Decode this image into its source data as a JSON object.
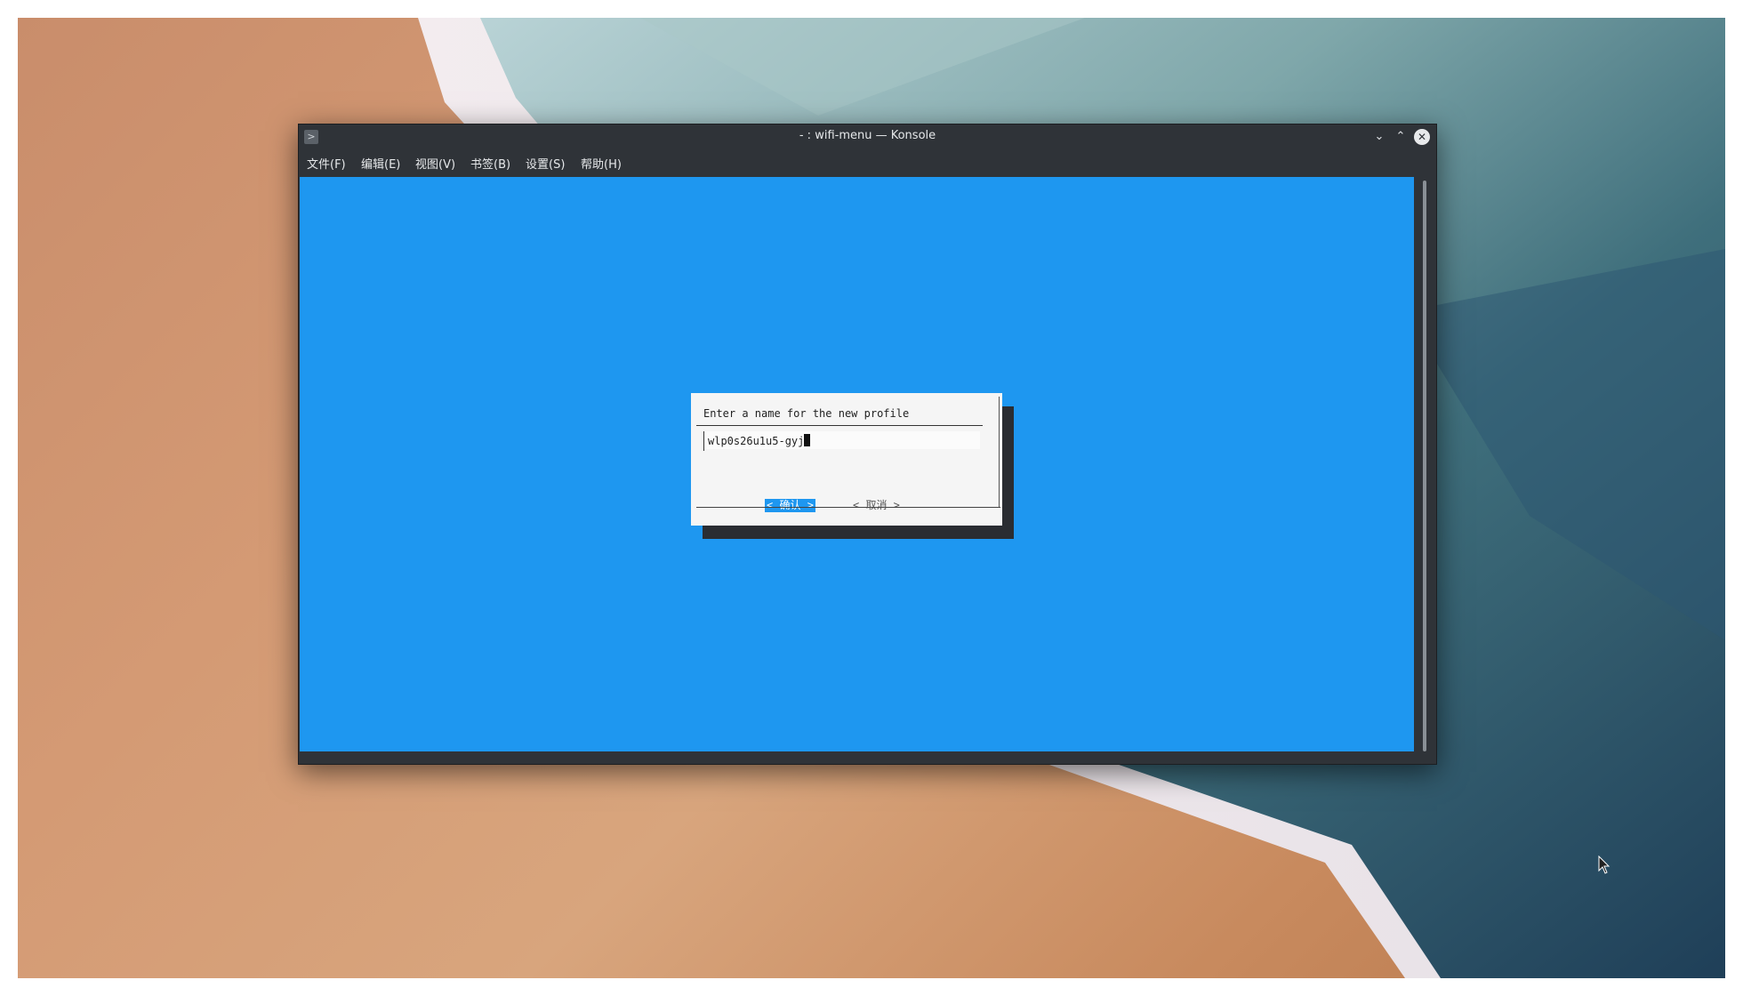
{
  "window": {
    "title": "- : wifi-menu — Konsole",
    "app_icon": "terminal-icon"
  },
  "window_controls": {
    "minimize": "chevron-down-icon",
    "maximize": "chevron-up-icon",
    "close": "close-icon"
  },
  "menubar": {
    "items": [
      {
        "label": "文件(F)"
      },
      {
        "label": "编辑(E)"
      },
      {
        "label": "视图(V)"
      },
      {
        "label": "书签(B)"
      },
      {
        "label": "设置(S)"
      },
      {
        "label": "帮助(H)"
      }
    ]
  },
  "dialog": {
    "prompt": "Enter a name for the new profile",
    "input_value": "wlp0s26u1u5-gyj",
    "ok_label": "< 确认 >",
    "cancel_label": "< 取消 >"
  },
  "colors": {
    "terminal_background": "#1e97f0",
    "window_chrome": "#2f3338",
    "dialog_background": "#f5f5f5"
  }
}
